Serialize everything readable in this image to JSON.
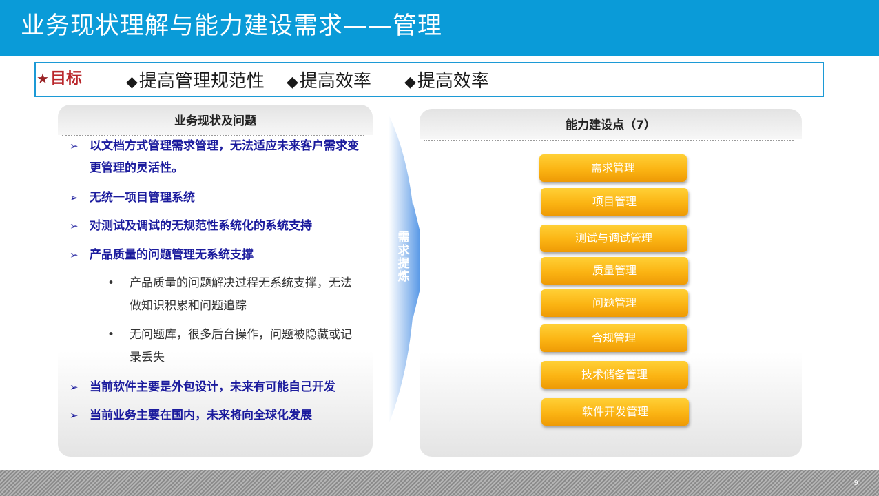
{
  "header": {
    "title": "业务现状理解与能力建设需求——管理"
  },
  "goal": {
    "star": "★",
    "label": "目标",
    "items": [
      "提高管理规范性",
      "提高效率",
      "提高效率"
    ],
    "diamond": "◆"
  },
  "left_panel": {
    "title": "业务现状及问题",
    "bullet": "➢",
    "sub_bullet": "•",
    "issues": [
      "以文档方式管理需求管理，无法适应未来客户需求变更管理的灵活性。",
      "无统一项目管理系统",
      "对测试及调试的无规范性系统化的系统支持",
      "产品质量的问题管理无系统支撑",
      "当前软件主要是外包设计，未来有可能自己开发",
      "当前业务主要在国内，未来将向全球化发展"
    ],
    "sub_items": [
      "产品质量的问题解决过程无系统支撑，无法做知识积累和问题追踪",
      "无问题库，很多后台操作，问题被隐藏或记录丢失"
    ]
  },
  "arrow": {
    "label": "需求提炼"
  },
  "right_panel": {
    "title": "能力建设点（7）",
    "capabilities": [
      "需求管理",
      "项目管理",
      "测试与调试管理",
      "质量管理",
      "问题管理",
      "合规管理",
      "技术储备管理",
      "软件开发管理"
    ]
  },
  "footer": {
    "page_number": "9"
  },
  "colors": {
    "header": "#0a9bd8",
    "goal_label": "#b9262b",
    "issue_text": "#1b1b9d",
    "button": "#fbb413"
  }
}
